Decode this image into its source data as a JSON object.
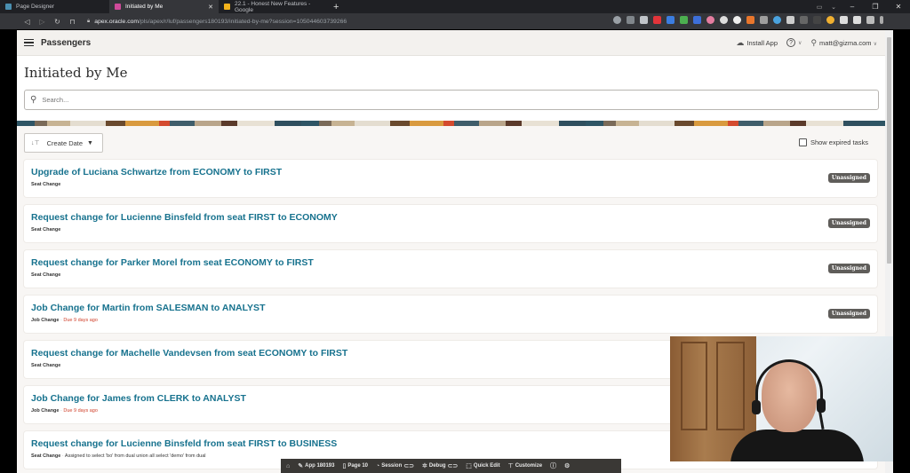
{
  "browser": {
    "tabs": [
      {
        "label": "Page Designer",
        "favicon_color": "#4a8fb0",
        "active": false
      },
      {
        "label": "Initiated by Me",
        "favicon_color": "#d04a9a",
        "active": true
      },
      {
        "label": "22.1 - Honest New Features - Google",
        "favicon_color": "#f2b21b",
        "active": false
      }
    ],
    "new_tab": "+",
    "url_host": "apex.oracle.com",
    "url_path": "/pls/apex/r/luf/passengers180193/initiated-by-me?session=105044603739266",
    "window_controls": {
      "minimize": "–",
      "restore": "❐",
      "close": "✕"
    }
  },
  "app": {
    "name": "Passengers",
    "install_app": "Install App",
    "help": "?",
    "user": "matt@gizma.com"
  },
  "page": {
    "title": "Initiated by Me",
    "search_placeholder": "Search...",
    "sort_label": "Create Date",
    "show_expired_label": "Show expired tasks"
  },
  "tasks": [
    {
      "title": "Upgrade of Luciana Schwartze from ECONOMY to FIRST",
      "type": "Seat Change",
      "due": "",
      "detail": "",
      "badge": "Unassigned"
    },
    {
      "title": "Request change for Lucienne Binsfeld from seat FIRST to ECONOMY",
      "type": "Seat Change",
      "due": "",
      "detail": "",
      "badge": "Unassigned"
    },
    {
      "title": "Request change for Parker Morel from seat ECONOMY to FIRST",
      "type": "Seat Change",
      "due": "",
      "detail": "",
      "badge": "Unassigned"
    },
    {
      "title": "Job Change for Martin from SALESMAN to ANALYST",
      "type": "Job Change",
      "due": "Due 9 days ago",
      "detail": "",
      "badge": "Unassigned"
    },
    {
      "title": "Request change for Machelle Vandevsen from seat ECONOMY to FIRST",
      "type": "Seat Change",
      "due": "",
      "detail": "",
      "badge": ""
    },
    {
      "title": "Job Change for James from CLERK to ANALYST",
      "type": "Job Change",
      "due": "Due 9 days ago",
      "detail": "",
      "badge": ""
    },
    {
      "title": "Request change for Lucienne Binsfeld from seat FIRST to BUSINESS",
      "type": "Seat Change",
      "due": "",
      "detail": "Assigned to select 'bo' from dual union all select 'demo' from dual",
      "badge": ""
    }
  ],
  "dev_toolbar": {
    "home": "⌂",
    "app": "App 180193",
    "page": "Page 10",
    "session": "Session",
    "debug": "Debug",
    "quick_edit": "Quick Edit",
    "customize": "Customize"
  },
  "colors": {
    "link": "#17728e",
    "due": "#d0402a",
    "badge_bg": "#5f5d5a"
  }
}
